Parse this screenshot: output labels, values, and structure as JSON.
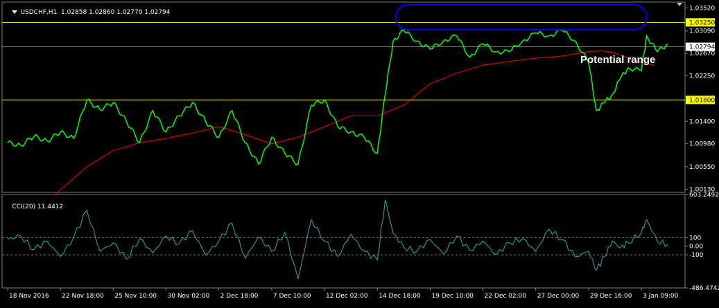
{
  "header": {
    "symbol": "USDCHF,H1",
    "open": "1.02858",
    "high": "1.02860",
    "low": "1.02770",
    "close": "1.02794"
  },
  "indicator_header": {
    "name": "CCI(20)",
    "value": "11.4412"
  },
  "annotation": "Potential range",
  "colors": {
    "background": "#000000",
    "price_line": "#00ff00",
    "moving_average": "#ff0000",
    "level_line": "#ffff00",
    "range_highlight": "#0000ff",
    "cci_line": "#20b2aa",
    "grid": "#808080",
    "text": "#ffffff",
    "current_price_label": "#ffffff"
  },
  "chart_data": [
    {
      "type": "line",
      "title": "USDCHF,H1",
      "x_ticks": [
        "18 Nov 2016",
        "22 Nov 18:00",
        "25 Nov 10:00",
        "30 Nov 02:00",
        "2 Dec 18:00",
        "7 Dec 10:00",
        "12 Dec 02:00",
        "14 Dec 18:00",
        "19 Dec 10:00",
        "22 Dec 02:00",
        "27 Dec 00:00",
        "29 Dec 16:00",
        "3 Jan 09:00"
      ],
      "y_ticks": [
        "1.03520",
        "1.03090",
        "1.02670",
        "1.02250",
        "1.01400",
        "1.00980",
        "1.00550",
        "1.00130"
      ],
      "ylim": [
        1.0007,
        1.0363
      ],
      "level_lines": [
        {
          "label": "1.03250",
          "value": 1.0325
        },
        {
          "label": "1.01800",
          "value": 1.018
        }
      ],
      "current_price": {
        "label": "1.02794",
        "value": 1.02794
      },
      "range_highlight": {
        "from_x": 14.7,
        "to_x": 24.2,
        "y_low": 1.0311,
        "y_high": 1.0358
      },
      "series": [
        {
          "kind": "price",
          "x": [
            0,
            0.5,
            1,
            1.5,
            2,
            2.5,
            3,
            3.5,
            4,
            4.5,
            5,
            5.5,
            6,
            6.5,
            7,
            7.5,
            8,
            8.5,
            9,
            9.5,
            10,
            10.5,
            11,
            11.5,
            12,
            12.5,
            13,
            13.5,
            14,
            14.3,
            14.6,
            15,
            15.5,
            16,
            16.5,
            17,
            17.5,
            18,
            18.5,
            19,
            19.5,
            20,
            20.5,
            21,
            21.5,
            22,
            22.3,
            22.6,
            22.9,
            23.2,
            23.5,
            24,
            24.2,
            24.6,
            25
          ],
          "values": [
            1.01,
            1.0095,
            1.0112,
            1.0103,
            1.012,
            1.0108,
            1.018,
            1.0162,
            1.0175,
            1.014,
            1.01,
            1.016,
            1.012,
            1.015,
            1.0175,
            1.014,
            1.011,
            1.016,
            1.01,
            1.006,
            1.011,
            1.008,
            1.006,
            1.017,
            1.018,
            1.013,
            1.012,
            1.011,
            1.008,
            1.019,
            1.029,
            1.031,
            1.029,
            1.0275,
            1.029,
            1.03,
            1.026,
            1.0285,
            1.027,
            1.027,
            1.029,
            1.0305,
            1.03,
            1.031,
            1.029,
            1.025,
            1.016,
            1.0175,
            1.019,
            1.022,
            1.024,
            1.0235,
            1.03,
            1.027,
            1.0285
          ]
        },
        {
          "kind": "moving_average",
          "x": [
            1.8,
            3,
            4,
            5,
            6,
            7,
            8,
            9,
            10,
            11,
            12,
            13,
            14,
            15,
            16,
            17,
            18,
            19,
            20,
            21,
            22,
            22.5,
            23,
            23.5,
            24,
            24.5
          ],
          "values": [
            1.0003,
            1.0055,
            1.0085,
            1.01,
            1.0108,
            1.0118,
            1.013,
            1.0115,
            1.0098,
            1.011,
            1.013,
            1.015,
            1.015,
            1.017,
            1.021,
            1.023,
            1.0245,
            1.0252,
            1.0258,
            1.0262,
            1.027,
            1.0272,
            1.0268,
            1.0258,
            1.025,
            1.0245
          ]
        }
      ]
    },
    {
      "type": "line",
      "title": "CCI(20)",
      "y_ticks": [
        "603.2492",
        "100",
        "0.00",
        "-100",
        "-486.4742"
      ],
      "ylim": [
        -486.4742,
        603.2492
      ],
      "reference_levels": [
        100,
        -100
      ],
      "series": [
        {
          "name": "CCI(20)",
          "x": [
            0,
            0.5,
            1,
            1.5,
            2,
            2.5,
            3,
            3.5,
            4,
            4.5,
            5,
            5.5,
            6,
            6.5,
            7,
            7.5,
            8,
            8.5,
            9,
            9.5,
            10,
            10.5,
            11,
            11.5,
            12,
            12.5,
            13,
            13.5,
            14,
            14.3,
            14.6,
            15,
            15.5,
            16,
            16.5,
            17,
            17.5,
            18,
            18.5,
            19,
            19.5,
            20,
            20.5,
            21,
            21.5,
            22,
            22.3,
            22.6,
            22.9,
            23.2,
            23.5,
            24,
            24.2,
            24.6,
            25
          ],
          "values": [
            80,
            120,
            -40,
            60,
            -120,
            100,
            420,
            -60,
            40,
            -150,
            90,
            -80,
            120,
            30,
            180,
            -100,
            60,
            270,
            -140,
            110,
            -60,
            160,
            -380,
            310,
            60,
            -120,
            140,
            -60,
            -160,
            540,
            150,
            -10,
            -60,
            80,
            -90,
            120,
            -50,
            60,
            -100,
            40,
            90,
            -60,
            200,
            80,
            -120,
            -60,
            -280,
            -120,
            60,
            -20,
            40,
            160,
            310,
            60,
            20
          ]
        }
      ]
    }
  ]
}
